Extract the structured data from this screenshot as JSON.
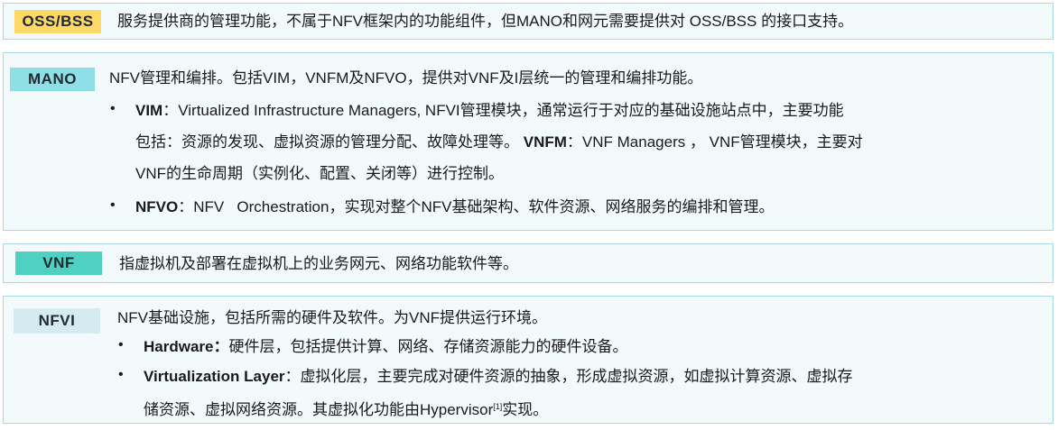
{
  "colors": {
    "oss_tag": "#ffd966",
    "mano_tag": "#8fe0e6",
    "vnf_tag": "#4fd1c2",
    "nfvi_tag": "#d6ebf0",
    "box_bg": "#f3fafc",
    "box_border": "#a8d8e3"
  },
  "oss": {
    "tag": "OSS/BSS",
    "desc": "服务提供商的管理功能，不属于NFV框架内的功能组件，但MANO和网元需要提供对 OSS/BSS 的接口支持。"
  },
  "mano": {
    "tag": "MANO",
    "desc": "NFV管理和编排。包括VIM，VNFM及NFVO，提供对VNF及I层统一的管理和编排功能。",
    "vim_term": "VIM",
    "vim_line1": "：Virtualized Infrastructure Managers, NFVI管理模块，通常运行于对应的基础设施站点中，主要功能",
    "vim_line2a": "包括：资源的发现、虚拟资源的管理分配、故障处理等。",
    "vnfm_term": "VNFM",
    "vim_line2b": "：VNF Managers ， VNF管理模块，主要对",
    "vim_line3": "VNF的生命周期（实例化、配置、关闭等）进行控制。",
    "nfvo_term": "NFVO",
    "nfvo_text": "：NFV   Orchestration，实现对整个NFV基础架构、软件资源、网络服务的编排和管理。"
  },
  "vnf": {
    "tag": "VNF",
    "desc": "指虚拟机及部署在虚拟机上的业务网元、网络功能软件等。"
  },
  "nfvi": {
    "tag": "NFVI",
    "desc": "NFV基础设施，包括所需的硬件及软件。为VNF提供运行环境。",
    "hw_term": "Hardware：",
    "hw_text": "硬件层，包括提供计算、网络、存储资源能力的硬件设备。",
    "vl_term": "Virtualization Layer",
    "vl_line1": "：虚拟化层，主要完成对硬件资源的抽象，形成虚拟资源，如虚拟计算资源、虚拟存",
    "vl_line2a": "储资源、虚拟网络资源。其虚拟化功能由Hypervisor",
    "vl_sup": "[1]",
    "vl_line2b": "实现。"
  },
  "bullet_char": "•"
}
